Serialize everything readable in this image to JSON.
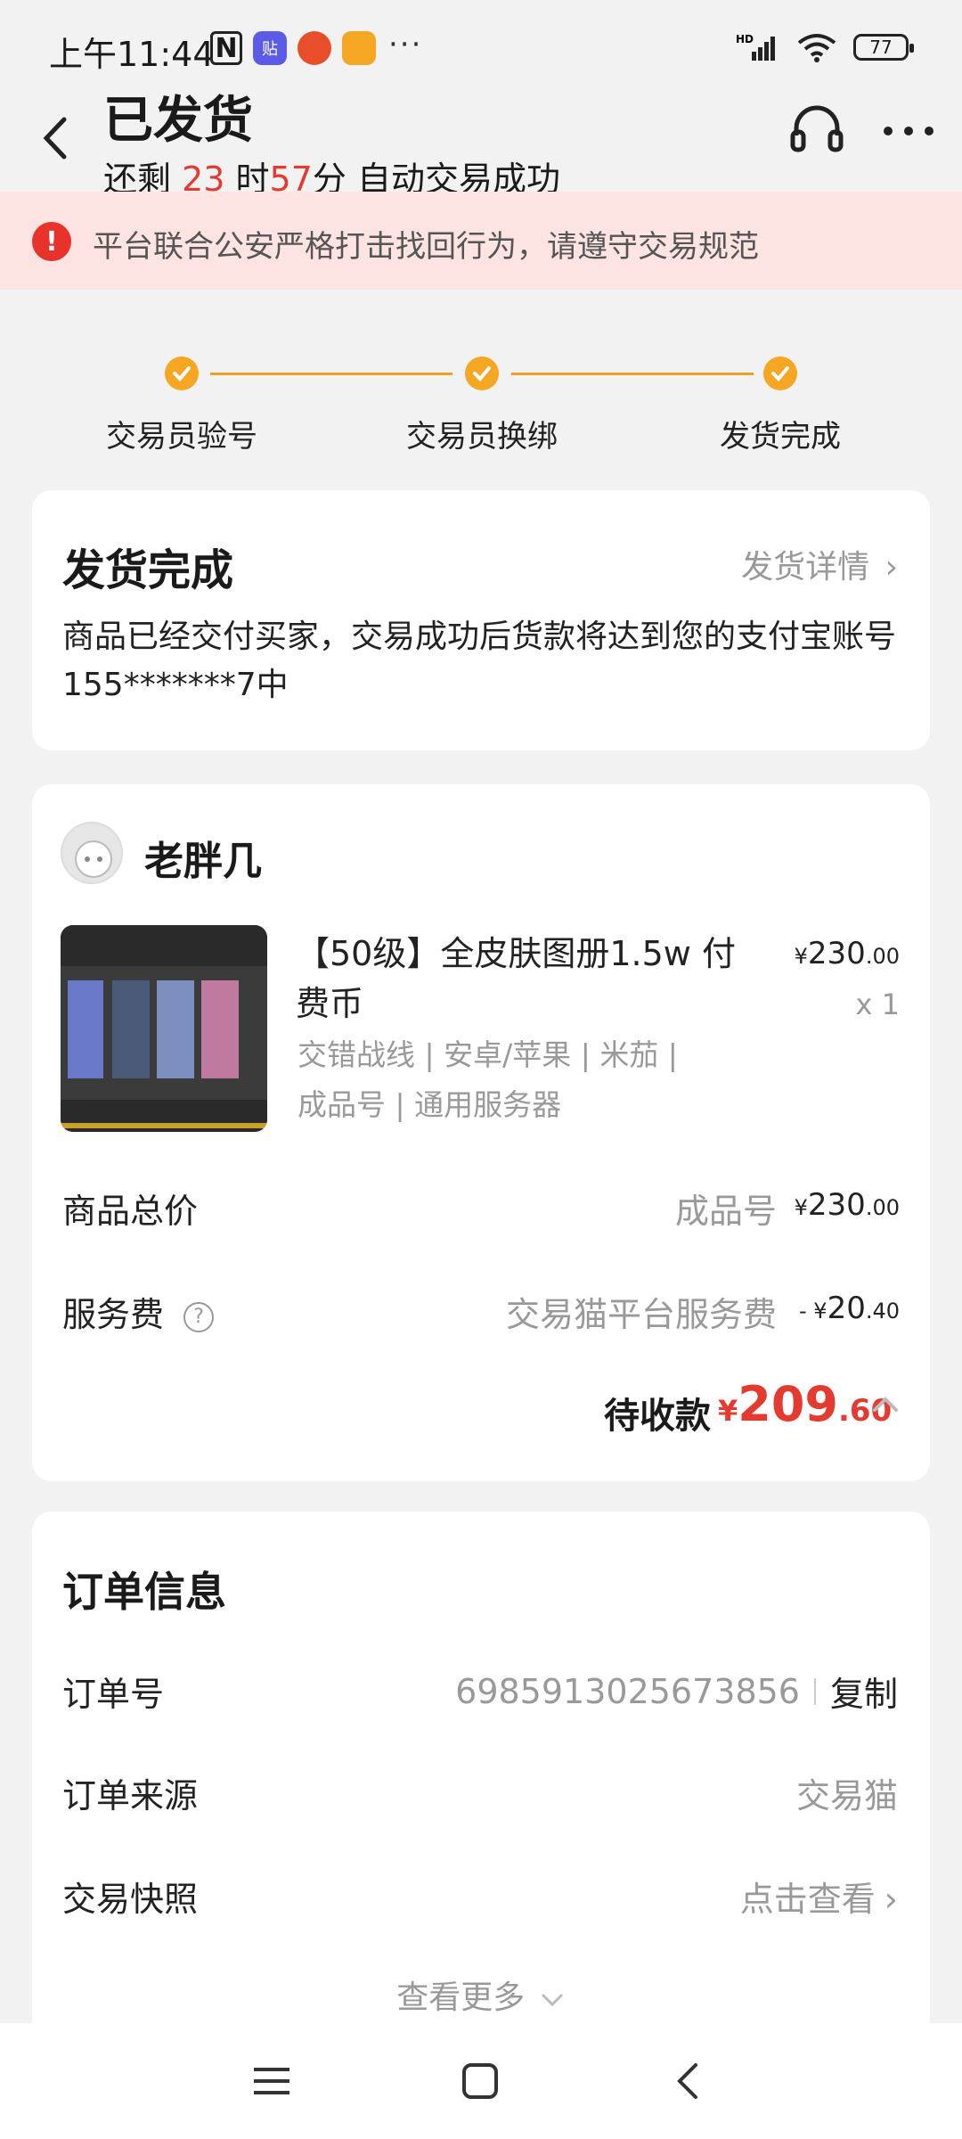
{
  "status": {
    "time": "上午11:44",
    "battery": "77"
  },
  "header": {
    "title": "已发货",
    "countdown": {
      "prefix": "还剩 ",
      "hours": "23",
      "hours_unit": " 时",
      "minutes": "57",
      "suffix": "分 自动交易成功"
    }
  },
  "notice": {
    "text": "平台联合公安严格打击找回行为，请遵守交易规范"
  },
  "steps": [
    {
      "label": "交易员验号"
    },
    {
      "label": "交易员换绑"
    },
    {
      "label": "发货完成"
    }
  ],
  "delivery": {
    "title": "发货完成",
    "link": "发货详情",
    "body": "商品已经交付买家，交易成功后货款将达到您的支付宝账号155*******7中"
  },
  "order_card": {
    "seller": "老胖几",
    "product": {
      "title": "【50级】全皮肤图册1.5w 付费币",
      "tags_line1": "交错战线 | 安卓/苹果 | 米茄 |",
      "tags_line2": "成品号 | 通用服务器",
      "price_symbol": "¥",
      "price_int": "230",
      "price_dec": ".00",
      "qty": "x 1"
    },
    "total": {
      "label": "商品总价",
      "mid": "成品号",
      "symbol": "¥",
      "int": "230",
      "dec": ".00"
    },
    "fee": {
      "label": "服务费",
      "mid": "交易猫平台服务费",
      "sign": "- ¥",
      "int": "20",
      "dec": ".40"
    },
    "due": {
      "label": "待收款",
      "symbol": "¥",
      "int": "209",
      "dec": ".60"
    }
  },
  "order_info": {
    "title": "订单信息",
    "rows": [
      {
        "label": "订单号",
        "value": "6985913025673856",
        "action": "复制"
      },
      {
        "label": "订单来源",
        "value": "交易猫"
      },
      {
        "label": "交易快照",
        "value": "点击查看"
      }
    ],
    "more": "查看更多"
  },
  "colors": {
    "accent": "#f5a623",
    "price_red": "#e53a2f",
    "notice_bg": "#fde3e1"
  }
}
